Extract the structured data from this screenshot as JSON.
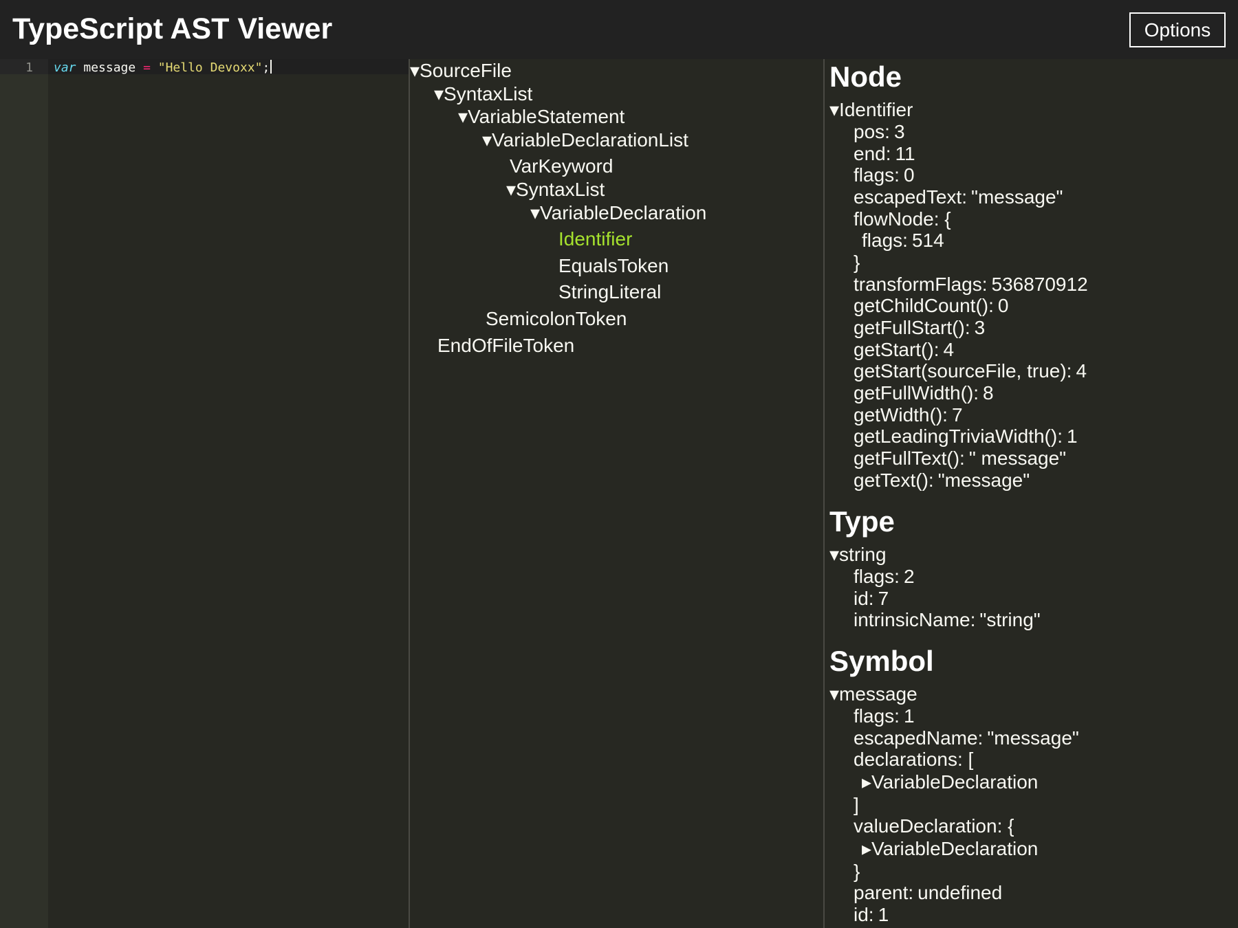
{
  "header": {
    "title": "TypeScript AST Viewer",
    "options_label": "Options"
  },
  "editor": {
    "line_number": "1",
    "code": {
      "kw": "var",
      "ident": " message ",
      "op": "=",
      "space": " ",
      "str": "\"Hello Devoxx\"",
      "semi": ";"
    }
  },
  "tree": {
    "source_file": "▾SourceFile",
    "syntax_list_1": "▾SyntaxList",
    "variable_statement": "▾VariableStatement",
    "variable_declaration_list": "▾VariableDeclarationList",
    "var_keyword": "VarKeyword",
    "syntax_list_2": "▾SyntaxList",
    "variable_declaration": "▾VariableDeclaration",
    "identifier": "Identifier",
    "equals_token": "EqualsToken",
    "string_literal": "StringLiteral",
    "semicolon_token": "SemicolonToken",
    "end_of_file_token": "EndOfFileToken"
  },
  "node": {
    "title": "Node",
    "header": "▾Identifier",
    "props": {
      "pos": {
        "key": "pos:",
        "value": "3"
      },
      "end": {
        "key": "end:",
        "value": "11"
      },
      "flags": {
        "key": "flags:",
        "value": "0"
      },
      "escaped_text": {
        "key": "escapedText:",
        "value": "\"message\""
      },
      "flow_node_open": "flowNode: {",
      "flow_flags": {
        "key": "flags:",
        "value": "514"
      },
      "flow_node_close": "}",
      "transform_flags": {
        "key": "transformFlags:",
        "value": "536870912"
      },
      "get_child_count": {
        "key": "getChildCount():",
        "value": "0"
      },
      "get_full_start": {
        "key": "getFullStart():",
        "value": "3"
      },
      "get_start": {
        "key": "getStart():",
        "value": "4"
      },
      "get_start_sf": {
        "key": "getStart(sourceFile, true):",
        "value": "4"
      },
      "get_full_width": {
        "key": "getFullWidth():",
        "value": "8"
      },
      "get_width": {
        "key": "getWidth():",
        "value": "7"
      },
      "get_leading_trivia_width": {
        "key": "getLeadingTriviaWidth():",
        "value": "1"
      },
      "get_full_text": {
        "key": "getFullText():",
        "value": "\" message\""
      },
      "get_text": {
        "key": "getText():",
        "value": "\"message\""
      }
    }
  },
  "type": {
    "title": "Type",
    "header": "▾string",
    "props": {
      "flags": {
        "key": "flags:",
        "value": "2"
      },
      "id": {
        "key": "id:",
        "value": "7"
      },
      "intrinsic_name": {
        "key": "intrinsicName:",
        "value": "\"string\""
      }
    }
  },
  "symbol": {
    "title": "Symbol",
    "header": "▾message",
    "props": {
      "flags": {
        "key": "flags:",
        "value": "1"
      },
      "escaped_name": {
        "key": "escapedName:",
        "value": "\"message\""
      },
      "declarations_open": "declarations: [",
      "declarations_item": "▸VariableDeclaration",
      "declarations_close": "]",
      "value_declaration_open": "valueDeclaration: {",
      "value_declaration_item": "▸VariableDeclaration",
      "value_declaration_close": "}",
      "parent": {
        "key": "parent:",
        "value": "undefined"
      },
      "id": {
        "key": "id:",
        "value": "1"
      }
    }
  }
}
